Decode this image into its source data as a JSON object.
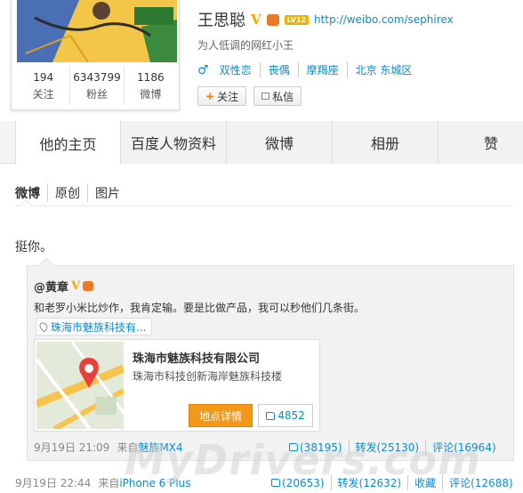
{
  "profile": {
    "name": "王思聪",
    "url": "http://weibo.com/sephirex",
    "lv_badge": "LV12",
    "bio": "为人低调的网红小王",
    "gender_icon": "♂",
    "tags": [
      "双性恋",
      "丧偶",
      "摩羯座",
      "北京 东城区"
    ],
    "stats": [
      {
        "num": "194",
        "label": "关注"
      },
      {
        "num": "6343799",
        "label": "粉丝"
      },
      {
        "num": "1186",
        "label": "微博"
      }
    ],
    "follow_label": "关注",
    "message_label": "私信"
  },
  "tabs": [
    "他的主页",
    "百度人物资料",
    "微博",
    "相册",
    "赞"
  ],
  "subnav": [
    "微博",
    "原创",
    "图片"
  ],
  "post": {
    "text": "挺你。",
    "repost": {
      "author": "@黄章",
      "text": "和老罗小米比炒作，我肯定输。要是比做产品，我可以秒他们几条街。",
      "location_chip": "珠海市魅族科技有...",
      "place": {
        "name": "珠海市魅族科技有限公司",
        "address": "珠海市科技创新海岸魅族科技楼",
        "detail_label": "地点详情",
        "likes": "4852"
      },
      "meta": {
        "time": "9月19日 21:09",
        "from_label": "来自",
        "source": "魅族MX4",
        "like": "(38195)",
        "forward": "转发(25130)",
        "comment": "评论(16964)"
      }
    },
    "meta": {
      "time": "9月19日 22:44",
      "from_label": "来自",
      "source": "iPhone 6 Plus",
      "like": "(20653)",
      "forward": "转发(12632)",
      "favorite": "收藏",
      "comment": "评论(12688)"
    }
  },
  "watermark": "MyDrivers.com",
  "colors": {
    "link": "#0a8cd2",
    "verified": "#f7a500",
    "detail_button": "#f29718",
    "map_pin": "#e8413a"
  }
}
